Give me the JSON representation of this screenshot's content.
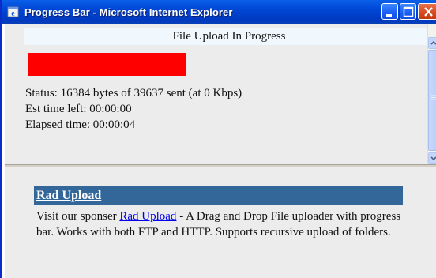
{
  "window": {
    "title": "Progress Bar - Microsoft Internet Explorer",
    "icon": "ie-icon",
    "buttons": [
      "minimize-icon",
      "maximize-icon",
      "close-icon"
    ]
  },
  "upload": {
    "heading": "File Upload In Progress",
    "progress_fraction": 0.41,
    "progress_color": "#ff0000",
    "status": "Status: 16384 bytes of 39637 sent (at 0 Kbps)",
    "est_time_left": "Est time left: 00:00:00",
    "elapsed_time": "Elapsed time: 00:00:04"
  },
  "sponsor": {
    "title": "Rad Upload",
    "text_before": "Visit our sponser ",
    "link": "Rad Upload",
    "text_after": " - A Drag and Drop File uploader with progress bar. Works with both FTP and HTTP. Supports recursive upload of folders.",
    "bar_color": "#336699"
  }
}
